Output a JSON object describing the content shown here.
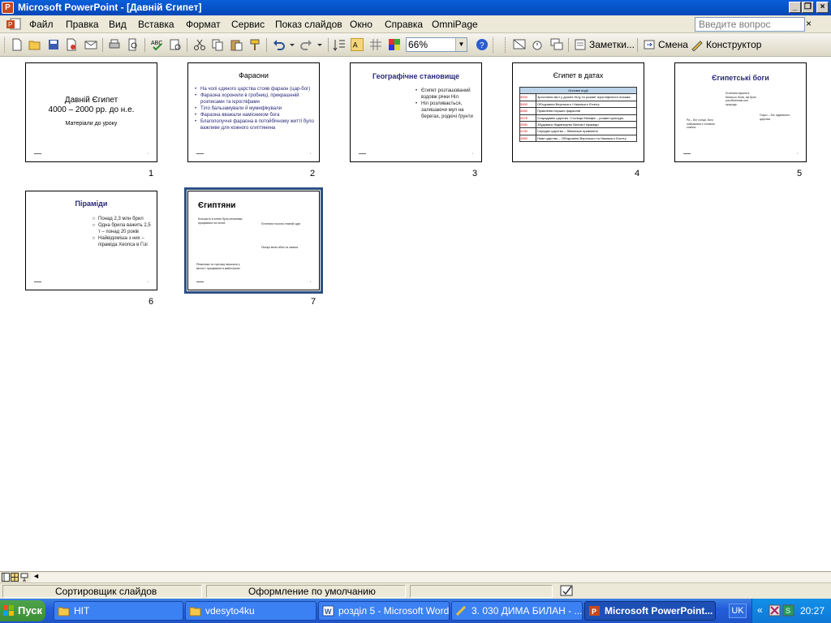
{
  "window": {
    "title": "Microsoft PowerPoint - [Давній Єгипет]",
    "controls": [
      "_",
      "❐",
      "×"
    ]
  },
  "menu": {
    "items": [
      "Файл",
      "Правка",
      "Вид",
      "Вставка",
      "Формат",
      "Сервис",
      "Показ слайдов",
      "Окно",
      "Справка",
      "OmniPage"
    ],
    "help_placeholder": "Введите вопрос",
    "close": "×"
  },
  "toolbar": {
    "zoom": "66%",
    "notes": "Заметки...",
    "change": "Смена",
    "designer": "Конструктор"
  },
  "slides": [
    {
      "num": "1",
      "title": "Давній Єгипет",
      "subtitle": "4000 – 2000 рр. до н.е.",
      "text": "Матеріали до уроку"
    },
    {
      "num": "2",
      "title": "Фараони",
      "bullets": [
        "На чолі єдиного царства стояв фараон (цар-бог)",
        "Фараона хоронили в гробниці, прикрашеній розписами та ієрогліфами",
        "Тіло бальзамували й мумифікували",
        "Фараона вважали намісником бога",
        "Благополуччя фараона в потойбічному житті було важливе для кожного єгиптянина"
      ]
    },
    {
      "num": "3",
      "title": "Географічне становище",
      "bullets": [
        "Єгипет розташований вздовж річки Ніл",
        "Ніл розливається, залишаючи мул на берегах, родючі ґрунти"
      ]
    },
    {
      "num": "4",
      "title": "Єгипет в датах",
      "table_header": "Основні події",
      "rows": [
        {
          "year": "3000",
          "event": "Зростання міст у долині Нілу та розквіт ієрогліфічного письма"
        },
        {
          "year": "3000",
          "event": "Об'єднання Верхнього і Нижнього Єгипту"
        },
        {
          "year": "2650",
          "event": "Правління перших фараонів"
        },
        {
          "year": "2575",
          "event": "Стародавнє царство. Столиця Мемфіс – розквіт культури"
        },
        {
          "year": "2550",
          "event": "Збудовано будівництво Великої піраміди"
        },
        {
          "year": "2130",
          "event": "Середнє царство – Фіванське правління"
        },
        {
          "year": "1550",
          "event": "Нове царство – Об'єднання Верхнього та Нижнього Єгипту"
        }
      ]
    },
    {
      "num": "5",
      "title": "Єгипетські боги",
      "t1": "Єгиптяни вірили в багатьох богів, які були уособленням сил природи",
      "t2": "Ра – бог сонця, його зображали з головою сокола",
      "t3": "Осіріс – бог підземного царства"
    },
    {
      "num": "6",
      "title": "Піраміди",
      "bullets": [
        "Понад 2,3 млн брил",
        "Одна брила важить 2,5 т – понад 20 років",
        "Найвідоміша з них – піраміда Хеопса в Гізі"
      ]
    },
    {
      "num": "7",
      "title": "Єгиптяни",
      "t1": "Більшість єгиптян були селянами, працювали на полях",
      "t2": "Єгиптяни носили лляний одяг",
      "t3": "Писарі вели облік та записи",
      "t4": "Ремісники та торговці мешкали у містах і працювали в майстернях"
    }
  ],
  "status": {
    "view": "Сортировщик слайдов",
    "design": "Оформление по умолчанию"
  },
  "taskbar": {
    "start": "Пуск",
    "tasks": [
      "HIT",
      "vdesyto4ku",
      "розділ 5 - Microsoft Word",
      "3. 030 ДИМА БИЛАН - ...",
      "Microsoft PowerPoint..."
    ],
    "lang": "UK",
    "tray_expand": "«",
    "clock": "20:27"
  },
  "colors": {
    "title_bar": "#0a5fd8",
    "taskbar": "#245edb",
    "start": "#3a8f35",
    "slide_title": "#28287a",
    "date_accent": "#cc0000"
  }
}
